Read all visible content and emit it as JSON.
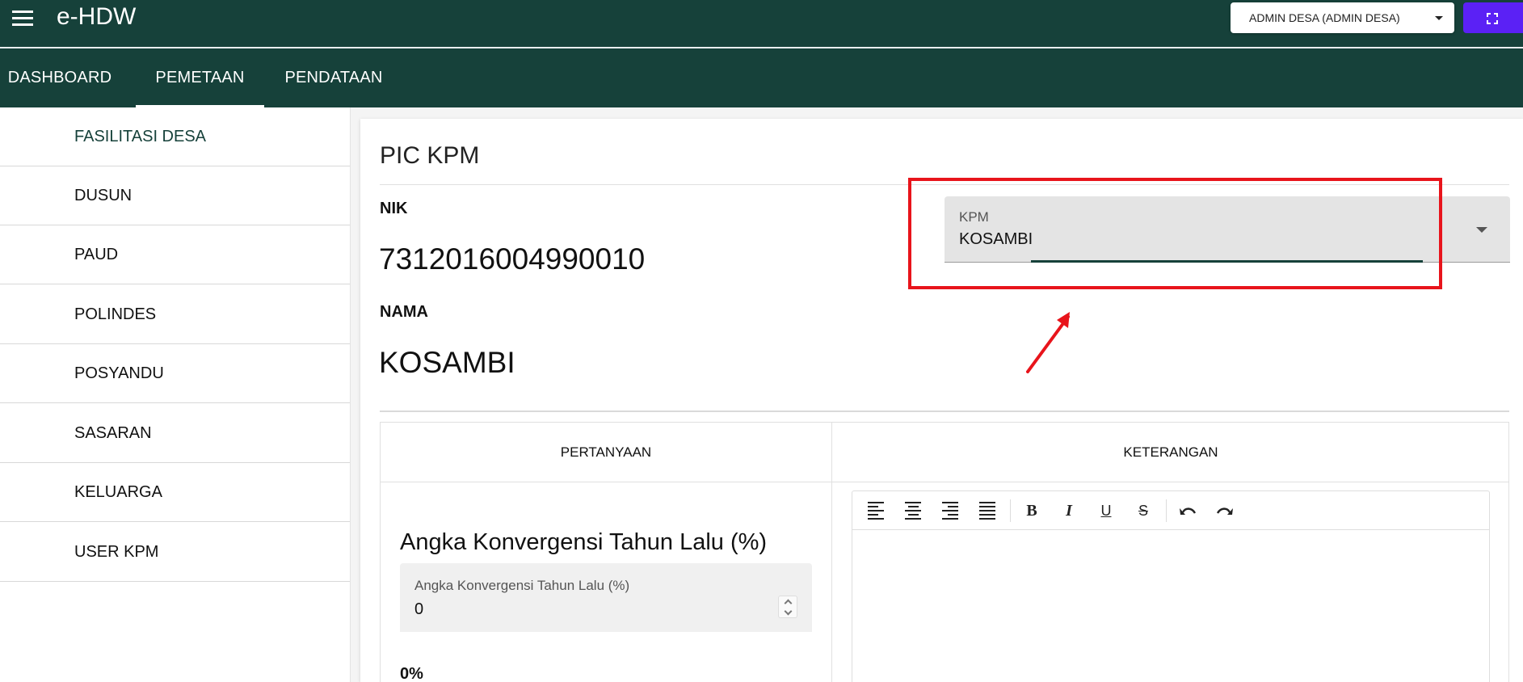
{
  "app": {
    "title": "e-HDW"
  },
  "header": {
    "user_label": "ADMIN DESA (ADMIN DESA)"
  },
  "tabs": [
    {
      "label": "DASHBOARD",
      "active": false
    },
    {
      "label": "PEMETAAN",
      "active": true
    },
    {
      "label": "PENDATAAN",
      "active": false
    }
  ],
  "sidebar": {
    "items": [
      {
        "label": "FASILITASI DESA",
        "active": true
      },
      {
        "label": "DUSUN"
      },
      {
        "label": "PAUD"
      },
      {
        "label": "POLINDES"
      },
      {
        "label": "POSYANDU"
      },
      {
        "label": "SASARAN"
      },
      {
        "label": "KELUARGA"
      },
      {
        "label": "USER KPM"
      }
    ]
  },
  "main": {
    "title": "PIC KPM",
    "nik_label": "NIK",
    "nik_value": "7312016004990010",
    "nama_label": "NAMA",
    "nama_value": "KOSAMBI",
    "kpm_select": {
      "label": "KPM",
      "value": "KOSAMBI"
    },
    "table": {
      "col_question": "PERTANYAAN",
      "col_note": "KETERANGAN",
      "question_title": "Angka Konvergensi Tahun Lalu (%)",
      "input_label": "Angka Konvergensi Tahun Lalu (%)",
      "input_value": "0",
      "percent_text": "0%"
    },
    "editor_toolbar": [
      "align-left-icon",
      "align-center-icon",
      "align-right-icon",
      "align-justify-icon",
      "bold-icon",
      "italic-icon",
      "underline-icon",
      "strikethrough-icon",
      "undo-icon",
      "redo-icon"
    ],
    "editor_glyphs": {
      "bold": "B",
      "italic": "I",
      "underline": "U",
      "strike": "S"
    }
  },
  "colors": {
    "primary": "#16413a",
    "fullscreen_button": "#5b21f5",
    "annotation": "#e8141b"
  }
}
